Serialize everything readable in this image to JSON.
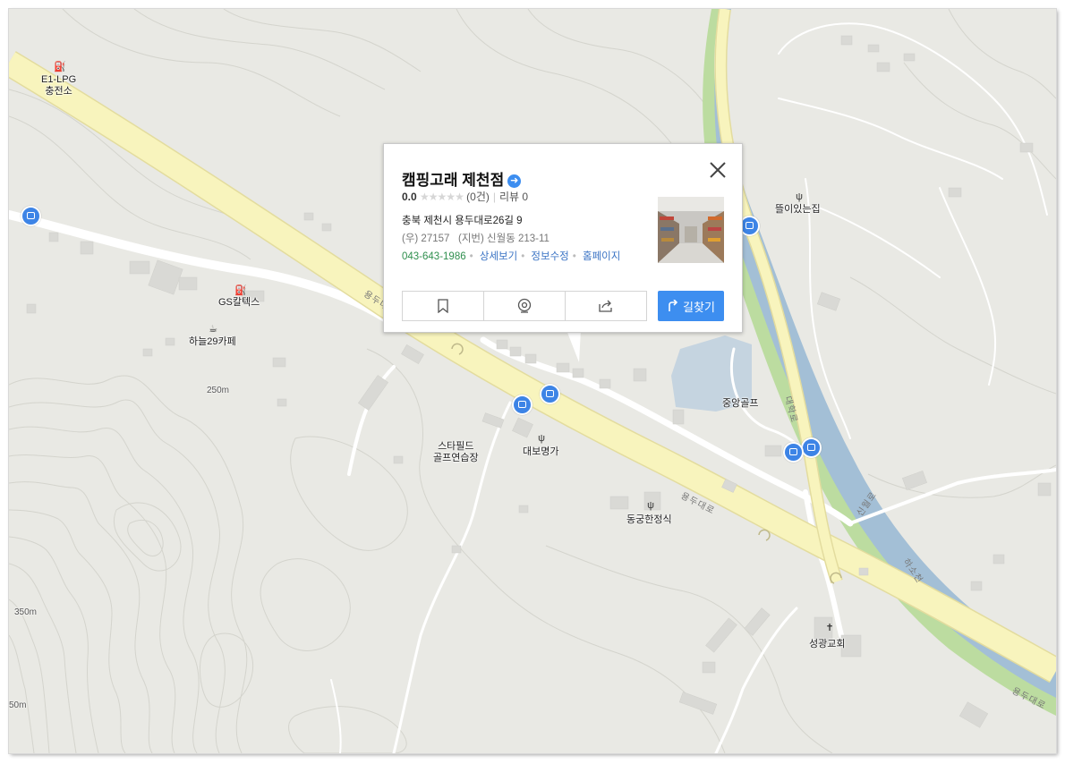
{
  "map": {
    "labels": {
      "e1lpg": "E1-LPG\n충전소",
      "gs": "GS칼텍스",
      "cafe": "하늘29카페",
      "restaurant_top": "뜰이있는집",
      "golf": "중앙골프",
      "starfield": "스타필드\n골프연습장",
      "daebo": "대보명가",
      "donggung": "동궁한정식",
      "church": "성광교회"
    },
    "elevations": {
      "e250": "250m",
      "e350": "350m",
      "e50": "50m"
    },
    "road_labels": {
      "yongdu1": "용두대로",
      "yongdu2": "용두대로",
      "yongdu3": "용두대로",
      "daehak": "대학로",
      "sinwol": "신월로",
      "hasocheon": "하소천"
    },
    "icons": {
      "gas": "gas-station-icon",
      "cafe": "cafe-icon",
      "restaurant": "restaurant-icon",
      "church": "church-icon",
      "bus": "bus-stop-icon"
    },
    "colors": {
      "land": "#e9e9e4",
      "highway": "#f8f4bd",
      "highway_edge": "#e3dc9e",
      "river": "#a3bfd6",
      "riverbank": "#b9dc9c",
      "road": "#ffffff",
      "contour": "#d6d6cf",
      "building": "#d9d9d5",
      "pond": "#c5d4e0",
      "bus": "#3d84e6"
    }
  },
  "popup": {
    "title": "캠핑고래 제천점",
    "rating": "0.0",
    "stars": "★★★★★",
    "review_count": "(0건)",
    "review_label": "리뷰 0",
    "address": "충북 제천시 용두대로26길 9",
    "address_postal": "(우) 27157",
    "address_lot": "(지번) 신월동 213-11",
    "phone": "043-643-1986",
    "link_detail": "상세보기",
    "link_edit": "정보수정",
    "link_home": "홈페이지",
    "route_label": "길찾기"
  }
}
